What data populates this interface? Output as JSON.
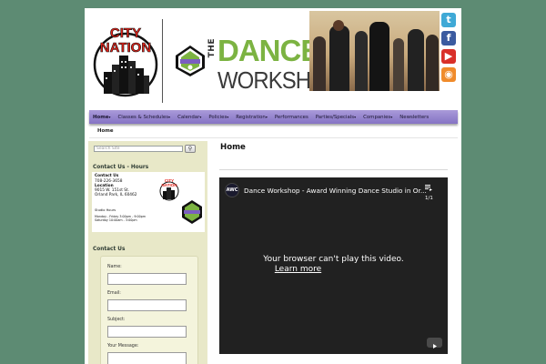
{
  "header": {
    "city_logo_text": [
      "CITY",
      "NATION"
    ],
    "dance_logo": {
      "the": "THE",
      "dance": "DANCE",
      "workshop": "WORKSHOP"
    }
  },
  "social": [
    {
      "icon": "twitter-icon",
      "glyph": "t",
      "color": "#3fa9d6"
    },
    {
      "icon": "facebook-icon",
      "glyph": "f",
      "color": "#3b5ba0"
    },
    {
      "icon": "youtube-icon",
      "glyph": "▶",
      "color": "#d9302a"
    },
    {
      "icon": "rss-icon",
      "glyph": "◉",
      "color": "#f08b2b"
    }
  ],
  "nav": {
    "items": [
      {
        "label": "Home",
        "caret": true,
        "active": true
      },
      {
        "label": "Classes & Schedules",
        "caret": true
      },
      {
        "label": "Calendar",
        "caret": true
      },
      {
        "label": "Policies",
        "caret": true
      },
      {
        "label": "Registration",
        "caret": true
      },
      {
        "label": "Performances",
        "caret": false
      },
      {
        "label": "Parties/Specials",
        "caret": true
      },
      {
        "label": "Companies",
        "caret": true
      },
      {
        "label": "Newsletters",
        "caret": false
      }
    ],
    "caret_glyph": "▾",
    "accent": "#9a8bd4"
  },
  "breadcrumb": "Home",
  "sidebar": {
    "search_placeholder": "Search Site",
    "search_icon": "magnifier-icon",
    "contact_hours_heading": "Contact Us - Hours",
    "contact_card": {
      "title": "Contact Us",
      "phone": "708-226-3658",
      "location_label": "Location",
      "address1": "9015 W. 151st St.",
      "address2": "Orland Park, IL 60462",
      "hours_title": "Studio Hours",
      "hours1": "Monday - Friday  3:00pm - 9:00pm",
      "hours2": "Saturday          10:00am - 3:00pm"
    },
    "contact_heading": "Contact Us",
    "form": {
      "name_label": "Name:",
      "email_label": "Email:",
      "subject_label": "Subject:",
      "message_label": "Your Message:"
    }
  },
  "main": {
    "title": "Home",
    "video": {
      "channel_badge": "AWC",
      "title": "Dance Workshop - Award Winning Dance Studio in Or...",
      "playlist_count": "1/1",
      "message_line1": "Your browser can't play this video.",
      "message_line2": "Learn more"
    }
  }
}
